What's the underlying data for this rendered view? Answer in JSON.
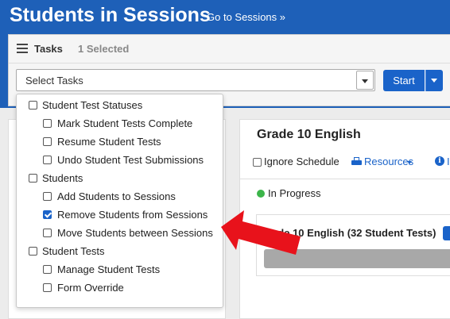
{
  "header": {
    "title": "Students in Sessions",
    "goto_link": "Go to Sessions »"
  },
  "tasks": {
    "title": "Tasks",
    "selected_count": "1 Selected",
    "select_placeholder": "Select Tasks",
    "start_label": "Start"
  },
  "dropdown": {
    "groups": [
      {
        "label": "Student Test Statuses",
        "checked": false,
        "items": [
          {
            "label": "Mark Student Tests Complete",
            "checked": false
          },
          {
            "label": "Resume Student Tests",
            "checked": false
          },
          {
            "label": "Undo Student Test Submissions",
            "checked": false
          }
        ]
      },
      {
        "label": "Students",
        "checked": false,
        "items": [
          {
            "label": "Add Students to Sessions",
            "checked": false
          },
          {
            "label": "Remove Students from Sessions",
            "checked": true
          },
          {
            "label": "Move Students between Sessions",
            "checked": false
          }
        ]
      },
      {
        "label": "Student Tests",
        "checked": false,
        "items": [
          {
            "label": "Manage Student Tests",
            "checked": false
          },
          {
            "label": "Form Override",
            "checked": false
          }
        ]
      }
    ]
  },
  "session": {
    "title": "Grade 10 English",
    "ignore_schedule_label": "Ignore Schedule",
    "resources_label": "Resources",
    "info_tail": "I",
    "status_label": "In Progress",
    "status_color": "#3cb54a",
    "test_card_title": "rade 10 English (32 Student Tests)"
  },
  "colors": {
    "brand_blue": "#1e60b8",
    "button_blue": "#1a63c9",
    "annotation_arrow": "#e8121b"
  },
  "icons": {
    "tasks": "list-icon",
    "resources": "printer-icon",
    "info": "info-circle-icon",
    "annotation": "red-arrow-icon"
  }
}
